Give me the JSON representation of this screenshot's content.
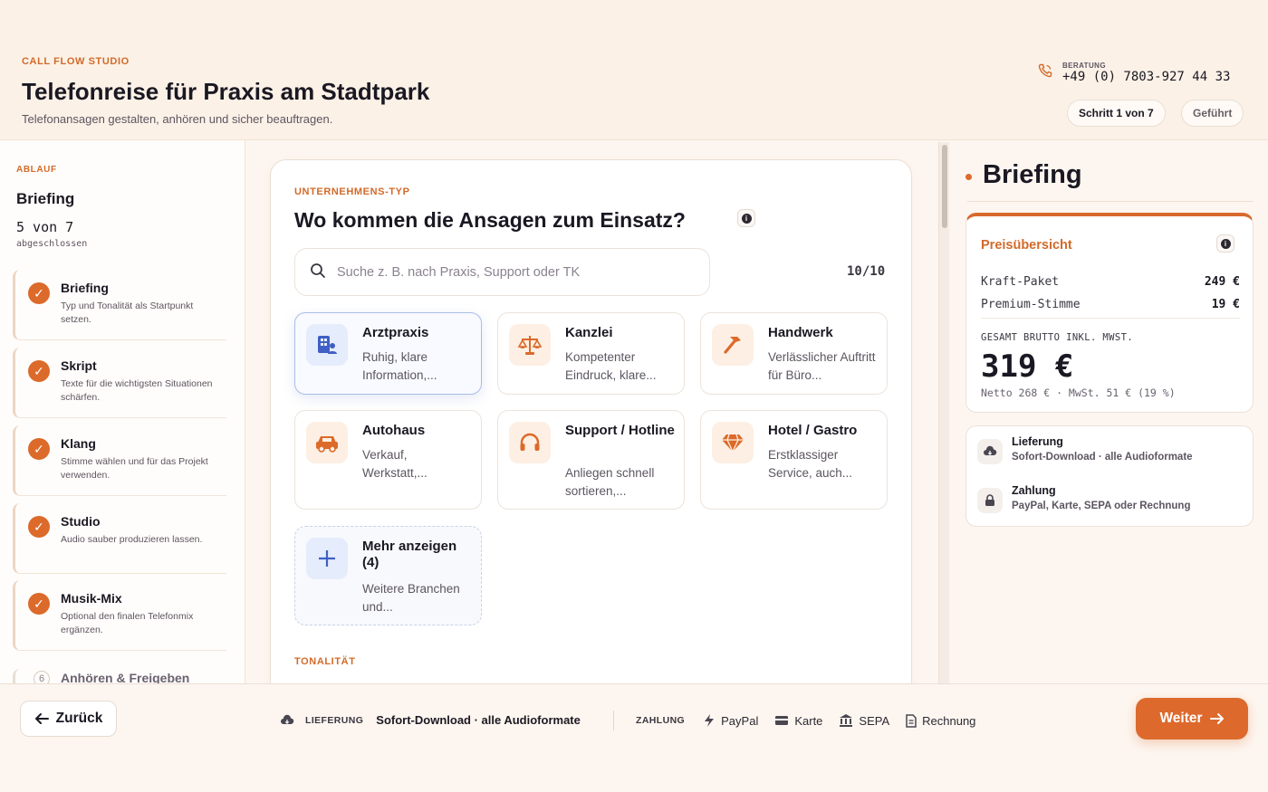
{
  "header": {
    "eyebrow": "CALL FLOW STUDIO",
    "title": "Telefonreise für Praxis am Stadtpark",
    "subtitle": "Telefonansagen gestalten, anhören und sicher beauftragen.",
    "contact_label": "BERATUNG",
    "contact_number": "+49 (0) 7803-927 44 33",
    "step_pill": "Schritt 1 von 7",
    "mode_pill": "Geführt"
  },
  "sidebar": {
    "eyebrow": "ABLAUF",
    "title": "Briefing",
    "progress": "5 von 7",
    "progress_sub": "abgeschlossen",
    "steps": [
      {
        "name": "Briefing",
        "desc": "Typ und Tonalität als Startpunkt setzen.",
        "done": true
      },
      {
        "name": "Skript",
        "desc": "Texte für die wichtigsten Situationen schärfen.",
        "done": true
      },
      {
        "name": "Klang",
        "desc": "Stimme wählen und für das Projekt verwenden.",
        "done": true
      },
      {
        "name": "Studio",
        "desc": "Audio sauber produzieren lassen.",
        "done": true
      },
      {
        "name": "Musik-Mix",
        "desc": "Optional den finalen Telefonmix ergänzen.",
        "done": true
      },
      {
        "name": "Anhören & Freigeben",
        "number": "6",
        "done": false
      }
    ]
  },
  "main": {
    "eyebrow": "UNTERNEHMENS-TYP",
    "title": "Wo kommen die Ansagen zum Einsatz?",
    "search_placeholder": "Suche z. B. nach Praxis, Support oder TK",
    "search_value": "",
    "result_count": "10/10",
    "tiles": [
      {
        "name": "Arztpraxis",
        "desc": "Ruhig, klare Information,...",
        "icon": "medical-building-icon"
      },
      {
        "name": "Kanzlei",
        "desc": "Kompetenter Eindruck, klare...",
        "icon": "scales-icon"
      },
      {
        "name": "Handwerk",
        "desc": "Verlässlicher Auftritt für Büro...",
        "icon": "hammer-icon"
      },
      {
        "name": "Autohaus",
        "desc": "Verkauf, Werkstatt,...",
        "icon": "car-icon"
      },
      {
        "name": "Support / Hotline",
        "desc": "Anliegen schnell sortieren,...",
        "icon": "headset-icon"
      },
      {
        "name": "Hotel / Gastro",
        "desc": "Erstklassiger Service, auch...",
        "icon": "gem-icon"
      },
      {
        "name": "Mehr anzeigen (4)",
        "desc": "Weitere Branchen und...",
        "icon": "plus-icon"
      }
    ],
    "next_section_eyebrow": "TONALITÄT"
  },
  "right": {
    "title": "Briefing",
    "price_heading": "Preisübersicht",
    "lines": [
      {
        "label": "Kraft-Paket",
        "amount": "249 €"
      },
      {
        "label": "Premium-Stimme",
        "amount": "19 €"
      }
    ],
    "total_label": "GESAMT BRUTTO INKL. MWST.",
    "total_value": "319 €",
    "total_breakdown": "Netto 268 € · MwSt. 51 € (19 %)",
    "delivery_label": "Lieferung",
    "delivery_value": "Sofort-Download · alle Audioformate",
    "payment_label": "Zahlung",
    "payment_value": "PayPal, Karte, SEPA oder Rechnung"
  },
  "footer": {
    "back_label": "Zurück",
    "delivery_label": "LIEFERUNG",
    "delivery_value": "Sofort-Download · alle Audioformate",
    "payment_label": "ZAHLUNG",
    "payment_methods": [
      "PayPal",
      "Karte",
      "SEPA",
      "Rechnung"
    ],
    "next_label": "Weiter"
  },
  "colors": {
    "accent": "#dd6a2c",
    "selected_border": "#a9bde6",
    "icon_blue": "#3f5fc4"
  }
}
